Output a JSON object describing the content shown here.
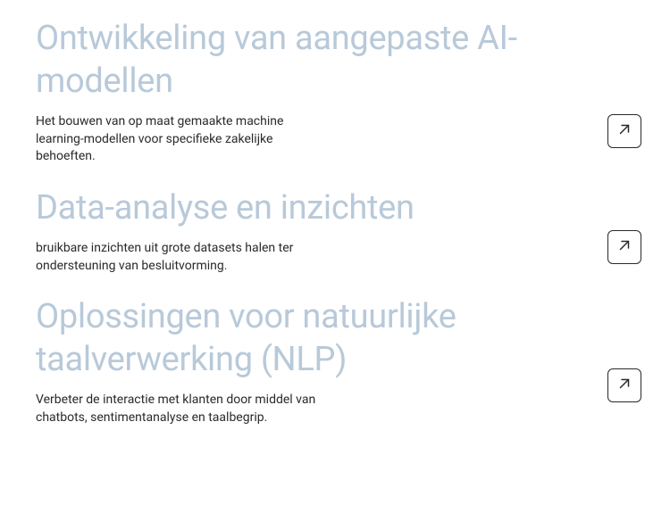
{
  "sections": [
    {
      "heading": "Ontwikkeling van aangepaste AI-modellen",
      "description": "Het bouwen van op maat gemaakte machine learning-modellen voor specifieke zakelijke behoeften."
    },
    {
      "heading": "Data-analyse en inzichten",
      "description": "bruikbare inzichten uit grote datasets halen ter ondersteuning van besluitvorming."
    },
    {
      "heading": "Oplossingen voor natuurlijke taalverwerking (NLP)",
      "description": "Verbeter de interactie met klanten door middel van chatbots, sentimentanalyse en taalbegrip."
    }
  ]
}
